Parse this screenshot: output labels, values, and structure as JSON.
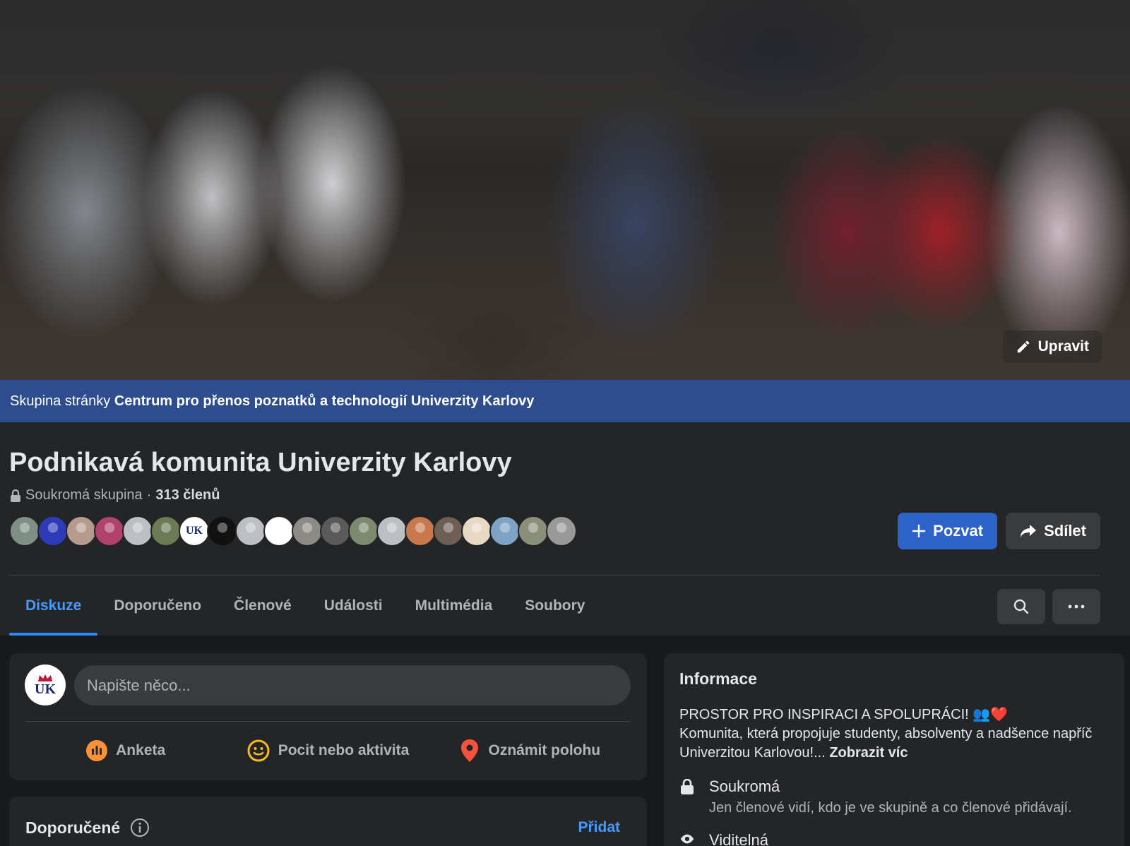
{
  "cover": {
    "edit_label": "Upravit"
  },
  "banner": {
    "prefix": "Skupina stránky",
    "page_name": "Centrum pro přenos poznatků a technologií Univerzity Karlovy"
  },
  "group": {
    "title": "Podnikavá komunita Univerzity Karlovy",
    "privacy": "Soukromá skupina",
    "separator": "·",
    "members": "313 členů",
    "avatar_colors": [
      "#7f8f86",
      "#2d3bb8",
      "#b79a8e",
      "#b1436a",
      "#bcc0c4",
      "#6c7a55",
      "#ffffff",
      "#111111",
      "#bcc0c4",
      "#ffffff",
      "#8e8a86",
      "#5a5a5a",
      "#7d8a70",
      "#bcc0c4",
      "#c7794d",
      "#6e5f55",
      "#e8d9c5",
      "#7ea3c4",
      "#8a8f7a",
      "#999999"
    ],
    "avatar_badge": "UK"
  },
  "actions": {
    "invite_label": "Pozvat",
    "share_label": "Sdílet"
  },
  "tabs": [
    {
      "label": "Diskuze",
      "active": true
    },
    {
      "label": "Doporučeno",
      "active": false
    },
    {
      "label": "Členové",
      "active": false
    },
    {
      "label": "Události",
      "active": false
    },
    {
      "label": "Multimédia",
      "active": false
    },
    {
      "label": "Soubory",
      "active": false
    }
  ],
  "composer": {
    "avatar_text": "UK",
    "placeholder": "Napište něco...",
    "actions": [
      {
        "label": "Anketa",
        "icon": "poll-icon",
        "color": "#f7923b"
      },
      {
        "label": "Pocit nebo aktivita",
        "icon": "smiley-icon",
        "color": "#f7b928"
      },
      {
        "label": "Oznámit polohu",
        "icon": "location-pin-icon",
        "color": "#f5533d"
      }
    ]
  },
  "recommended": {
    "title": "Doporučené",
    "add_label": "Přidat"
  },
  "info": {
    "title": "Informace",
    "desc_line1": "PROSTOR PRO INSPIRACI A SPOLUPRÁCI! 👥❤️",
    "desc_line2": "Komunita, která propojuje studenty, absolventy a nadšence napříč Univerzitou Karlovou!...",
    "more_label": "Zobrazit víc",
    "private_title": "Soukromá",
    "private_desc": "Jen členové vidí, kdo je ve skupině a co členové přidávají.",
    "visible_title": "Viditelná"
  },
  "colors": {
    "accent": "#2d63c8",
    "link": "#4599ff",
    "banner": "#2e4d8f",
    "bg": "#18191a",
    "card": "#242526"
  }
}
